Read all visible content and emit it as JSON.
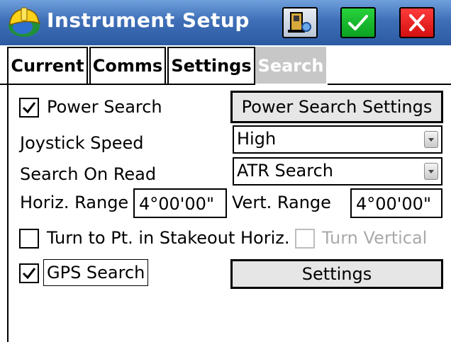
{
  "window": {
    "title": "Instrument Setup",
    "buttons": {
      "instrument": "instrument-icon",
      "ok": "checkmark-icon",
      "cancel": "close-icon"
    },
    "colors": {
      "titlebar": "#3f6fb7",
      "ok": "#16b82c",
      "cancel": "#e31b1b",
      "active_tab": "#c7c7c7"
    }
  },
  "tabs": [
    "Current",
    "Comms",
    "Settings",
    "Search"
  ],
  "active_tab": "Search",
  "search": {
    "power_search": {
      "label": "Power Search",
      "checked": true
    },
    "power_search_settings_button": "Power Search Settings",
    "joystick_speed": {
      "label": "Joystick Speed",
      "value": "High"
    },
    "search_on_read": {
      "label": "Search On Read",
      "value": "ATR Search"
    },
    "horiz_range": {
      "label": "Horiz. Range",
      "value": "4°00'00\""
    },
    "vert_range": {
      "label": "Vert. Range",
      "value": "4°00'00\""
    },
    "turn_to_pt": {
      "label": "Turn to Pt. in Stakeout Horiz.",
      "checked": false
    },
    "turn_vertical": {
      "label": "Turn Vertical",
      "checked": false,
      "enabled": false
    },
    "gps_search": {
      "label": "GPS Search",
      "checked": true
    },
    "gps_settings_button": "Settings"
  }
}
